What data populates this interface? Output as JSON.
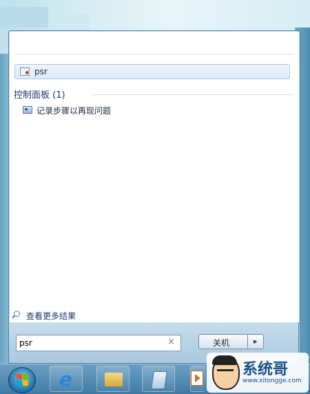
{
  "search_results": {
    "top_item": {
      "label": "psr",
      "icon": "program-icon"
    }
  },
  "control_panel": {
    "heading": "控制面板 (1)",
    "items": [
      {
        "label": "记录步骤以再现问题",
        "icon": "problem-steps-recorder-icon"
      }
    ]
  },
  "more_results": {
    "label": "查看更多结果",
    "icon": "search-icon"
  },
  "search": {
    "value": "psr",
    "clear": "×"
  },
  "shutdown": {
    "label": "关机",
    "arrow": "▸"
  },
  "taskbar": {
    "items": [
      "start-orb",
      "internet-explorer-icon",
      "file-explorer-icon",
      "document-icon",
      "media-player-icon"
    ]
  },
  "watermark": {
    "title": "系统哥",
    "url": "www.xitongge.com"
  }
}
